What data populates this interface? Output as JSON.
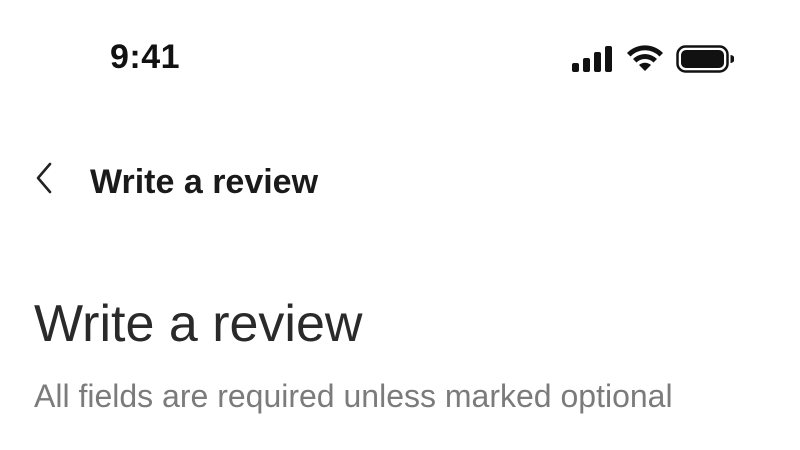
{
  "status_bar": {
    "time": "9:41",
    "icons": [
      "cellular-signal-icon",
      "wifi-icon",
      "battery-icon"
    ]
  },
  "nav": {
    "back_icon": "chevron-left-icon",
    "title": "Write a review"
  },
  "header": {
    "title": "Write a review",
    "subtitle": "All fields are required unless marked optional"
  },
  "colors": {
    "text_primary": "#222222",
    "text_secondary": "#7b7b7b",
    "background": "#ffffff"
  }
}
